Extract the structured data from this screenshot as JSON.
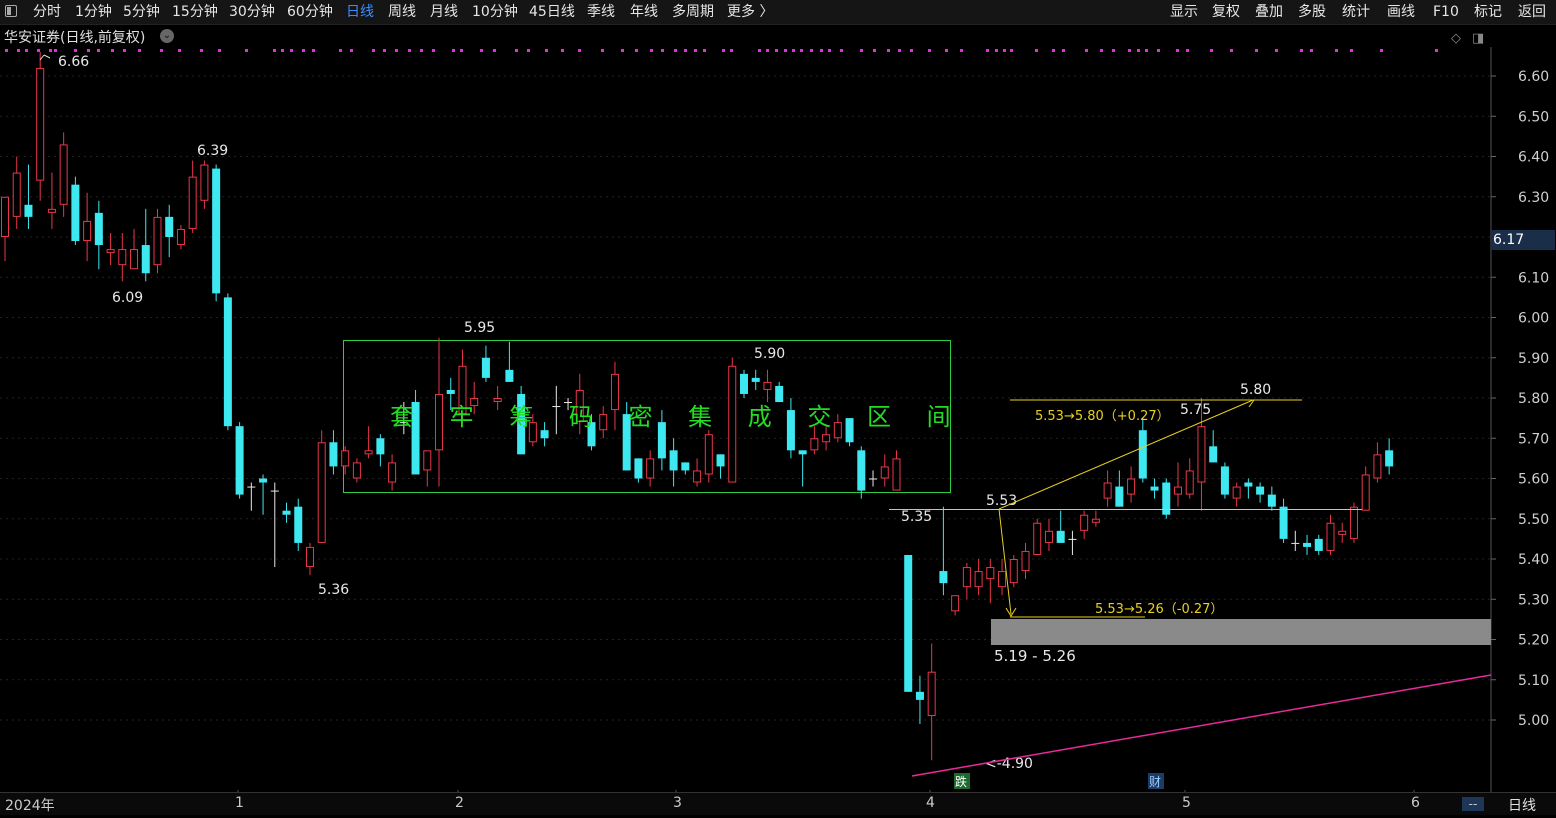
{
  "toolbar": {
    "left_items": [
      "分时",
      "1分钟",
      "5分钟",
      "15分钟",
      "30分钟",
      "60分钟",
      "日线",
      "周线",
      "月线",
      "10分钟",
      "45日线",
      "季线",
      "年线",
      "多周期",
      "更多 〉"
    ],
    "active_item": "日线",
    "right_items": [
      "显示",
      "复权",
      "叠加",
      "多股",
      "统计",
      "画线",
      "F10",
      "标记",
      "返回"
    ]
  },
  "title": "华安证券(日线,前复权)",
  "current_price_label": "6.17",
  "period_label": "日线",
  "scroll_button": "--",
  "chart_data": {
    "type": "candlestick",
    "y_ticks": [
      "6.60",
      "6.50",
      "6.40",
      "6.30",
      "6.20",
      "6.10",
      "6.00",
      "5.90",
      "5.80",
      "5.70",
      "5.60",
      "5.50",
      "5.40",
      "5.30",
      "5.20",
      "5.10",
      "5.00"
    ],
    "x_labels": [
      "2024年",
      "1",
      "2",
      "3",
      "4",
      "5",
      "6"
    ],
    "colors": {
      "up": "#e8374a",
      "down": "#3ee8f0",
      "box": "#2ecc40",
      "box_text": "#22dd22",
      "yellow": "#e8d020",
      "pink": "#e82a9a",
      "marker": "#e030e0"
    },
    "candles": [
      {
        "o": 6.2,
        "h": 6.3,
        "l": 6.14,
        "c": 6.3
      },
      {
        "o": 6.25,
        "h": 6.4,
        "l": 6.22,
        "c": 6.36
      },
      {
        "o": 6.28,
        "h": 6.38,
        "l": 6.22,
        "c": 6.25
      },
      {
        "o": 6.34,
        "h": 6.66,
        "l": 6.29,
        "c": 6.62
      },
      {
        "o": 6.26,
        "h": 6.36,
        "l": 6.22,
        "c": 6.27
      },
      {
        "o": 6.28,
        "h": 6.46,
        "l": 6.25,
        "c": 6.43
      },
      {
        "o": 6.33,
        "h": 6.35,
        "l": 6.18,
        "c": 6.19
      },
      {
        "o": 6.19,
        "h": 6.31,
        "l": 6.14,
        "c": 6.24
      },
      {
        "o": 6.26,
        "h": 6.29,
        "l": 6.12,
        "c": 6.18
      },
      {
        "o": 6.16,
        "h": 6.21,
        "l": 6.13,
        "c": 6.17
      },
      {
        "o": 6.13,
        "h": 6.21,
        "l": 6.09,
        "c": 6.17
      },
      {
        "o": 6.12,
        "h": 6.22,
        "l": 6.12,
        "c": 6.17
      },
      {
        "o": 6.18,
        "h": 6.27,
        "l": 6.09,
        "c": 6.11
      },
      {
        "o": 6.13,
        "h": 6.27,
        "l": 6.11,
        "c": 6.25
      },
      {
        "o": 6.25,
        "h": 6.28,
        "l": 6.15,
        "c": 6.2
      },
      {
        "o": 6.18,
        "h": 6.23,
        "l": 6.17,
        "c": 6.22
      },
      {
        "o": 6.22,
        "h": 6.39,
        "l": 6.21,
        "c": 6.35
      },
      {
        "o": 6.29,
        "h": 6.39,
        "l": 6.27,
        "c": 6.38
      },
      {
        "o": 6.37,
        "h": 6.38,
        "l": 6.04,
        "c": 6.06
      },
      {
        "o": 6.05,
        "h": 6.06,
        "l": 5.72,
        "c": 5.73
      },
      {
        "o": 5.73,
        "h": 5.74,
        "l": 5.55,
        "c": 5.56
      },
      {
        "o": 5.58,
        "h": 5.59,
        "l": 5.52,
        "c": 5.58
      },
      {
        "o": 5.6,
        "h": 5.61,
        "l": 5.51,
        "c": 5.59
      },
      {
        "o": 5.57,
        "h": 5.59,
        "l": 5.38,
        "c": 5.57
      },
      {
        "o": 5.52,
        "h": 5.54,
        "l": 5.49,
        "c": 5.51
      },
      {
        "o": 5.53,
        "h": 5.55,
        "l": 5.42,
        "c": 5.44
      },
      {
        "o": 5.38,
        "h": 5.44,
        "l": 5.36,
        "c": 5.43
      },
      {
        "o": 5.44,
        "h": 5.72,
        "l": 5.44,
        "c": 5.69
      },
      {
        "o": 5.69,
        "h": 5.72,
        "l": 5.61,
        "c": 5.63
      },
      {
        "o": 5.63,
        "h": 5.68,
        "l": 5.61,
        "c": 5.67
      },
      {
        "o": 5.6,
        "h": 5.65,
        "l": 5.59,
        "c": 5.64
      },
      {
        "o": 5.66,
        "h": 5.73,
        "l": 5.65,
        "c": 5.67
      },
      {
        "o": 5.7,
        "h": 5.71,
        "l": 5.63,
        "c": 5.66
      },
      {
        "o": 5.59,
        "h": 5.66,
        "l": 5.57,
        "c": 5.64
      },
      {
        "o": 5.74,
        "h": 5.79,
        "l": 5.71,
        "c": 5.74
      },
      {
        "o": 5.79,
        "h": 5.82,
        "l": 5.65,
        "c": 5.61
      },
      {
        "o": 5.62,
        "h": 5.66,
        "l": 5.58,
        "c": 5.67
      },
      {
        "o": 5.67,
        "h": 5.95,
        "l": 5.58,
        "c": 5.81
      },
      {
        "o": 5.82,
        "h": 5.85,
        "l": 5.77,
        "c": 5.81
      },
      {
        "o": 5.76,
        "h": 5.92,
        "l": 5.74,
        "c": 5.88
      },
      {
        "o": 5.78,
        "h": 5.84,
        "l": 5.76,
        "c": 5.8
      },
      {
        "o": 5.9,
        "h": 5.93,
        "l": 5.84,
        "c": 5.85
      },
      {
        "o": 5.79,
        "h": 5.83,
        "l": 5.77,
        "c": 5.8
      },
      {
        "o": 5.87,
        "h": 5.94,
        "l": 5.84,
        "c": 5.84
      },
      {
        "o": 5.81,
        "h": 5.83,
        "l": 5.66,
        "c": 5.66
      },
      {
        "o": 5.69,
        "h": 5.76,
        "l": 5.68,
        "c": 5.74
      },
      {
        "o": 5.72,
        "h": 5.74,
        "l": 5.68,
        "c": 5.7
      },
      {
        "o": 5.78,
        "h": 5.83,
        "l": 5.71,
        "c": 5.78
      },
      {
        "o": 5.79,
        "h": 5.8,
        "l": 5.77,
        "c": 5.79
      },
      {
        "o": 5.74,
        "h": 5.86,
        "l": 5.71,
        "c": 5.82
      },
      {
        "o": 5.74,
        "h": 5.76,
        "l": 5.67,
        "c": 5.68
      },
      {
        "o": 5.72,
        "h": 5.78,
        "l": 5.7,
        "c": 5.76
      },
      {
        "o": 5.77,
        "h": 5.89,
        "l": 5.72,
        "c": 5.86
      },
      {
        "o": 5.76,
        "h": 5.79,
        "l": 5.62,
        "c": 5.62
      },
      {
        "o": 5.65,
        "h": 5.65,
        "l": 5.59,
        "c": 5.6
      },
      {
        "o": 5.6,
        "h": 5.67,
        "l": 5.58,
        "c": 5.65
      },
      {
        "o": 5.74,
        "h": 5.77,
        "l": 5.62,
        "c": 5.65
      },
      {
        "o": 5.67,
        "h": 5.7,
        "l": 5.58,
        "c": 5.62
      },
      {
        "o": 5.64,
        "h": 5.64,
        "l": 5.61,
        "c": 5.62
      },
      {
        "o": 5.59,
        "h": 5.65,
        "l": 5.58,
        "c": 5.62
      },
      {
        "o": 5.61,
        "h": 5.72,
        "l": 5.59,
        "c": 5.71
      },
      {
        "o": 5.66,
        "h": 5.66,
        "l": 5.6,
        "c": 5.63
      },
      {
        "o": 5.59,
        "h": 5.9,
        "l": 5.59,
        "c": 5.88
      },
      {
        "o": 5.86,
        "h": 5.87,
        "l": 5.8,
        "c": 5.81
      },
      {
        "o": 5.85,
        "h": 5.87,
        "l": 5.82,
        "c": 5.84
      },
      {
        "o": 5.82,
        "h": 5.87,
        "l": 5.79,
        "c": 5.84
      },
      {
        "o": 5.83,
        "h": 5.84,
        "l": 5.79,
        "c": 5.79
      },
      {
        "o": 5.77,
        "h": 5.8,
        "l": 5.65,
        "c": 5.67
      },
      {
        "o": 5.67,
        "h": 5.67,
        "l": 5.58,
        "c": 5.66
      },
      {
        "o": 5.67,
        "h": 5.73,
        "l": 5.66,
        "c": 5.7
      },
      {
        "o": 5.69,
        "h": 5.73,
        "l": 5.67,
        "c": 5.71
      },
      {
        "o": 5.7,
        "h": 5.76,
        "l": 5.69,
        "c": 5.74
      },
      {
        "o": 5.75,
        "h": 5.75,
        "l": 5.68,
        "c": 5.69
      },
      {
        "o": 5.67,
        "h": 5.68,
        "l": 5.55,
        "c": 5.57
      },
      {
        "o": 5.6,
        "h": 5.62,
        "l": 5.58,
        "c": 5.6
      },
      {
        "o": 5.6,
        "h": 5.66,
        "l": 5.58,
        "c": 5.63
      },
      {
        "o": 5.57,
        "h": 5.67,
        "l": 5.57,
        "c": 5.65
      },
      {
        "o": 5.41,
        "h": 5.41,
        "l": 5.07,
        "c": 5.07
      },
      {
        "o": 5.07,
        "h": 5.11,
        "l": 4.99,
        "c": 5.05
      },
      {
        "o": 5.01,
        "h": 5.19,
        "l": 4.9,
        "c": 5.12
      },
      {
        "o": 5.37,
        "h": 5.53,
        "l": 5.31,
        "c": 5.34
      },
      {
        "o": 5.27,
        "h": 5.31,
        "l": 5.26,
        "c": 5.31
      },
      {
        "o": 5.33,
        "h": 5.39,
        "l": 5.3,
        "c": 5.38
      },
      {
        "o": 5.33,
        "h": 5.4,
        "l": 5.31,
        "c": 5.37
      },
      {
        "o": 5.35,
        "h": 5.4,
        "l": 5.29,
        "c": 5.38
      },
      {
        "o": 5.33,
        "h": 5.4,
        "l": 5.31,
        "c": 5.37
      },
      {
        "o": 5.34,
        "h": 5.41,
        "l": 5.33,
        "c": 5.4
      },
      {
        "o": 5.37,
        "h": 5.44,
        "l": 5.35,
        "c": 5.42
      },
      {
        "o": 5.41,
        "h": 5.5,
        "l": 5.41,
        "c": 5.49
      },
      {
        "o": 5.44,
        "h": 5.5,
        "l": 5.42,
        "c": 5.47
      },
      {
        "o": 5.47,
        "h": 5.52,
        "l": 5.44,
        "c": 5.44
      },
      {
        "o": 5.45,
        "h": 5.47,
        "l": 5.41,
        "c": 5.45
      },
      {
        "o": 5.47,
        "h": 5.52,
        "l": 5.45,
        "c": 5.51
      },
      {
        "o": 5.49,
        "h": 5.52,
        "l": 5.48,
        "c": 5.5
      },
      {
        "o": 5.55,
        "h": 5.62,
        "l": 5.53,
        "c": 5.59
      },
      {
        "o": 5.58,
        "h": 5.62,
        "l": 5.53,
        "c": 5.53
      },
      {
        "o": 5.56,
        "h": 5.63,
        "l": 5.54,
        "c": 5.6
      },
      {
        "o": 5.72,
        "h": 5.75,
        "l": 5.59,
        "c": 5.6
      },
      {
        "o": 5.58,
        "h": 5.6,
        "l": 5.55,
        "c": 5.57
      },
      {
        "o": 5.59,
        "h": 5.6,
        "l": 5.5,
        "c": 5.51
      },
      {
        "o": 5.56,
        "h": 5.64,
        "l": 5.53,
        "c": 5.58
      },
      {
        "o": 5.56,
        "h": 5.65,
        "l": 5.55,
        "c": 5.62
      },
      {
        "o": 5.59,
        "h": 5.8,
        "l": 5.52,
        "c": 5.73
      },
      {
        "o": 5.68,
        "h": 5.72,
        "l": 5.64,
        "c": 5.64
      },
      {
        "o": 5.63,
        "h": 5.64,
        "l": 5.55,
        "c": 5.56
      },
      {
        "o": 5.55,
        "h": 5.59,
        "l": 5.53,
        "c": 5.58
      },
      {
        "o": 5.59,
        "h": 5.6,
        "l": 5.55,
        "c": 5.58
      },
      {
        "o": 5.58,
        "h": 5.59,
        "l": 5.54,
        "c": 5.56
      },
      {
        "o": 5.56,
        "h": 5.58,
        "l": 5.52,
        "c": 5.53
      },
      {
        "o": 5.53,
        "h": 5.55,
        "l": 5.44,
        "c": 5.45
      },
      {
        "o": 5.44,
        "h": 5.47,
        "l": 5.42,
        "c": 5.44
      },
      {
        "o": 5.44,
        "h": 5.46,
        "l": 5.41,
        "c": 5.43
      },
      {
        "o": 5.45,
        "h": 5.46,
        "l": 5.41,
        "c": 5.42
      },
      {
        "o": 5.42,
        "h": 5.51,
        "l": 5.41,
        "c": 5.49
      },
      {
        "o": 5.46,
        "h": 5.49,
        "l": 5.44,
        "c": 5.47
      },
      {
        "o": 5.45,
        "h": 5.54,
        "l": 5.44,
        "c": 5.53
      },
      {
        "o": 5.52,
        "h": 5.63,
        "l": 5.52,
        "c": 5.61
      },
      {
        "o": 5.6,
        "h": 5.69,
        "l": 5.59,
        "c": 5.66
      },
      {
        "o": 5.67,
        "h": 5.7,
        "l": 5.61,
        "c": 5.63
      }
    ],
    "price_labels": [
      {
        "text": "6.66",
        "price": 6.66,
        "idx": 3
      },
      {
        "text": "6.09",
        "price": 6.09,
        "idx": 10
      },
      {
        "text": "6.39",
        "price": 6.39,
        "idx": 17
      },
      {
        "text": "5.36",
        "price": 5.36,
        "idx": 26
      },
      {
        "text": "5.95",
        "price": 5.95,
        "idx": 37
      },
      {
        "text": "5.90",
        "price": 5.9,
        "idx": 62
      },
      {
        "text": "5.35",
        "price": 5.35,
        "idx": 73
      },
      {
        "text": "5.53",
        "price": 5.53,
        "idx": 80
      },
      {
        "text": "5.75",
        "price": 5.75,
        "idx": 98
      },
      {
        "text": "5.80",
        "price": 5.8,
        "idx": 103
      },
      {
        "text": "5.26",
        "price": 5.26,
        "idx": 81
      },
      {
        "text": "<-4.90",
        "price": 4.9,
        "idx": 79
      }
    ],
    "box_text": "套 牢 筹 码 密 集 成 交 区 间",
    "annotations": {
      "up_measure": "5.53→5.80（+0.27）",
      "down_measure": "5.53→5.26（-0.27）",
      "zone_range": "5.19 - 5.26",
      "event_down": "跌",
      "event_fin": "财"
    }
  }
}
